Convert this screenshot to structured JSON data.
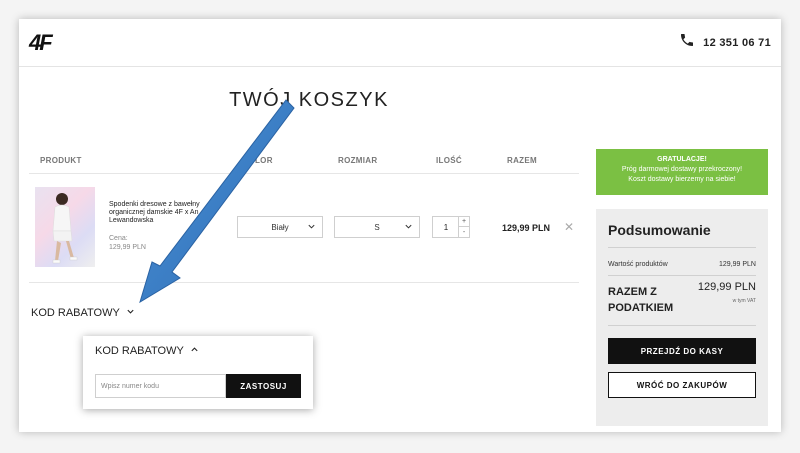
{
  "header": {
    "logo": "4F",
    "phone": "12 351 06 71"
  },
  "page_title": "TWÓJ KOSZYK",
  "table": {
    "columns": [
      "PRODUKT",
      "KOLOR",
      "ROZMIAR",
      "ILOŚĆ",
      "RAZEM"
    ],
    "visible_columns": {
      "product": "PRODUKT",
      "color_partial": "LOR",
      "size": "ROZMIAR",
      "qty": "ILOŚĆ",
      "total": "RAZEM"
    }
  },
  "cart_item": {
    "name_line1": "Spodenki dresowe z bawełny",
    "name_line2": "organicznej damskie 4F x An",
    "name_line3": "Lewandowska",
    "price_label": "Cena:",
    "price": "129,99 PLN",
    "color": "Biały",
    "size": "S",
    "quantity": "1",
    "line_total": "129,99 PLN"
  },
  "discount": {
    "toggle_label": "KOD RABATOWY",
    "popup_title": "KOD RABATOWY",
    "input_placeholder": "Wpisz numer kodu",
    "apply_label": "ZASTOSUJ"
  },
  "promo": {
    "title": "GRATULACJE!",
    "line1": "Próg darmowej dostawy przekroczony!",
    "line2": "Koszt dostawy bierzemy na siebie!"
  },
  "summary": {
    "title": "Podsumowanie",
    "products_value_label": "Wartość produktów",
    "products_value": "129,99 PLN",
    "total_label_1": "RAZEM Z",
    "total_label_2": "PODATKIEM",
    "total_value": "129,99 PLN",
    "vat_note": "w tym VAT",
    "checkout_label": "PRZEJDŹ DO KASY",
    "continue_label": "WRÓĆ DO ZAKUPÓW"
  },
  "colors": {
    "accent_green": "#7bc043",
    "arrow_blue": "#3a7fc6",
    "dark": "#111111"
  }
}
